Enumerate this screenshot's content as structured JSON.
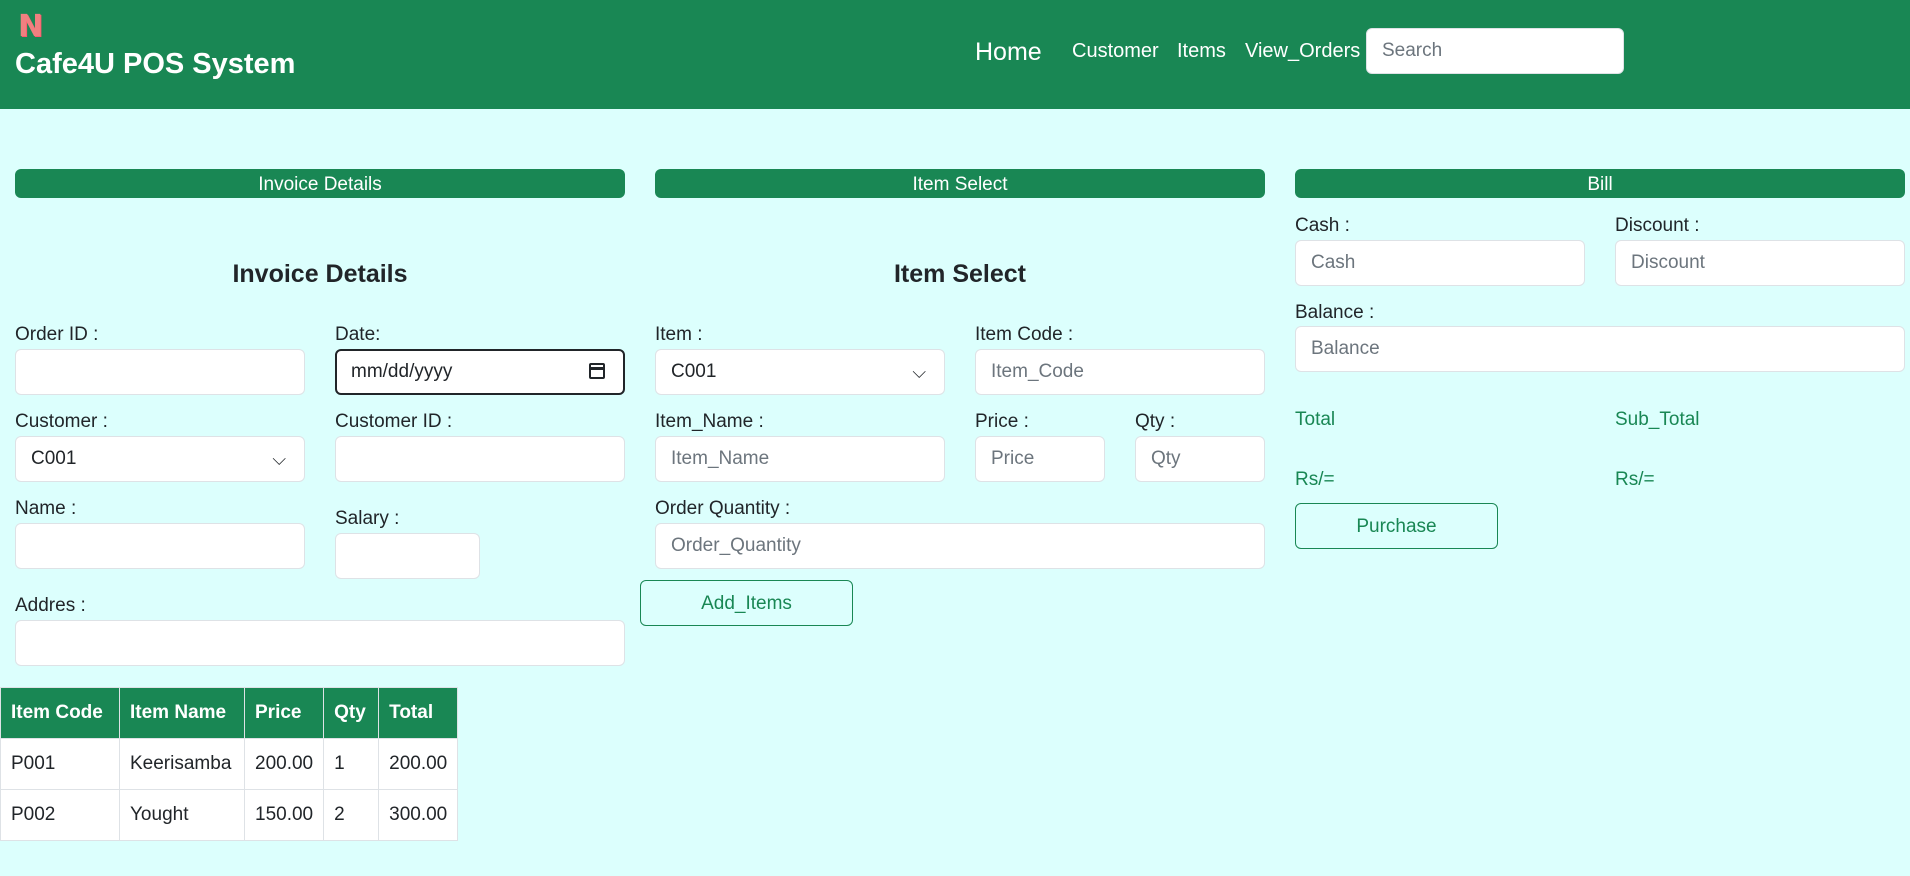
{
  "navbar": {
    "logo_glyph": "N",
    "brand": "Cafe4U POS System",
    "links": [
      "Home",
      "Customer",
      "Items",
      "View_Orders"
    ],
    "search_placeholder": "Search"
  },
  "invoice": {
    "header": "Invoice Details",
    "title": "Invoice Details",
    "order_id_label": "Order ID :",
    "date_label": "Date:",
    "date_value": "mm/dd/yyyy",
    "customer_label": "Customer :",
    "customer_value": "C001",
    "customer_id_label": "Customer ID :",
    "name_label": "Name :",
    "salary_label": "Salary :",
    "address_label": "Addres :"
  },
  "item_select": {
    "header": "Item Select",
    "title": "Item Select",
    "item_label": "Item :",
    "item_value": "C001",
    "item_code_label": "Item Code :",
    "item_code_placeholder": "Item_Code",
    "item_name_label": "Item_Name :",
    "item_name_placeholder": "Item_Name",
    "price_label": "Price :",
    "price_placeholder": "Price",
    "qty_label": "Qty :",
    "qty_placeholder": "Qty",
    "order_qty_label": "Order Quantity :",
    "order_qty_placeholder": "Order_Quantity",
    "add_button": "Add_Items"
  },
  "bill": {
    "header": "Bill",
    "cash_label": "Cash :",
    "cash_placeholder": "Cash",
    "discount_label": "Discount :",
    "discount_placeholder": "Discount",
    "balance_label": "Balance :",
    "balance_placeholder": "Balance",
    "total_label": "Total",
    "subtotal_label": "Sub_Total",
    "total_value": "Rs/=",
    "subtotal_value": "Rs/=",
    "purchase_button": "Purchase"
  },
  "table": {
    "headers": [
      "Item Code",
      "Item Name",
      "Price",
      "Qty",
      "Total"
    ],
    "rows": [
      [
        "P001",
        "Keerisamba",
        "200.00",
        "1",
        "200.00"
      ],
      [
        "P002",
        "Yought",
        "150.00",
        "2",
        "300.00"
      ]
    ]
  }
}
